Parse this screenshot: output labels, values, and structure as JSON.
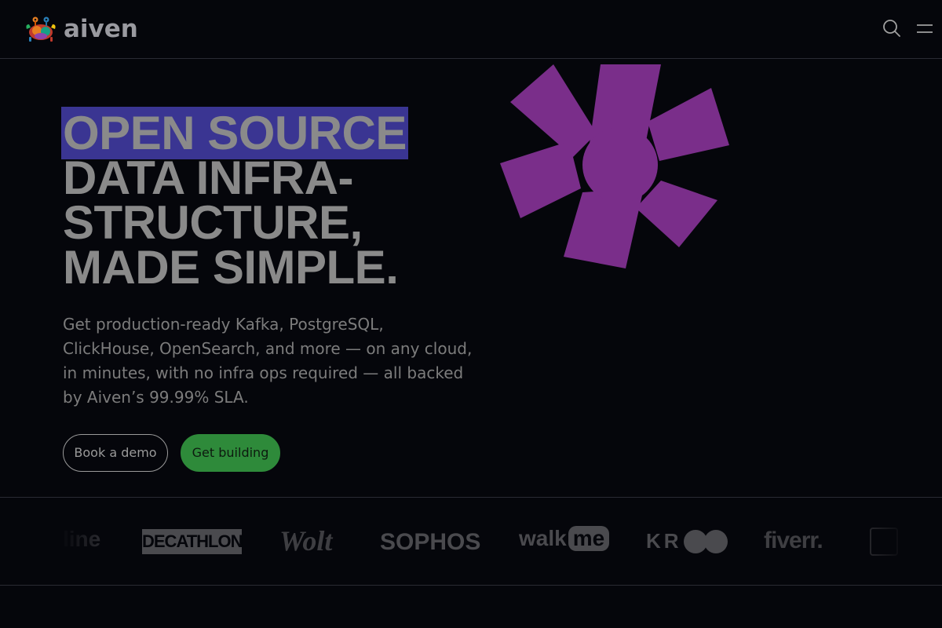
{
  "header": {
    "logo_text": "aiven",
    "search_icon": "search-icon",
    "menu_icon": "hamburger-menu-icon"
  },
  "hero": {
    "title_highlight": "OPEN SOURCE",
    "title_line2": "DATA INFRA-",
    "title_line3": "STRUCTURE,",
    "title_line4": "MADE SIMPLE.",
    "subtitle": "Get production-ready Kafka, PostgreSQL, ClickHouse, OpenSearch, and more — on any cloud, in minutes, with no infra ops required — all backed by Aiven’s 99.99% SLA.",
    "cta_secondary": "Book a demo",
    "cta_primary": "Get building",
    "highlight_color": "#3a3592",
    "accent_color": "#7a2e8a",
    "primary_button_color": "#2e8a3a"
  },
  "customer_logos": {
    "items": [
      "line",
      "DECATHLON",
      "Wolt",
      "SOPHOS",
      "walk",
      "me",
      "KR",
      "fiverr."
    ]
  }
}
